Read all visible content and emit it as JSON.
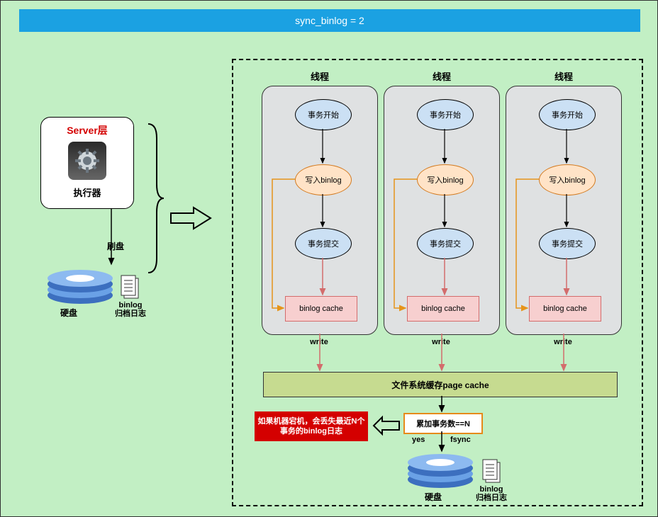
{
  "banner": {
    "title": "sync_binlog = 2"
  },
  "server": {
    "title": "Server层",
    "subtitle": "执行器"
  },
  "flush_label": "刷盘",
  "left_disk": {
    "caption": "硬盘",
    "file_label_line1": "binlog",
    "file_label_line2": "归档日志"
  },
  "threads": {
    "label": "线程",
    "steps": {
      "begin": "事务开始",
      "write_binlog": "写入binlog",
      "commit": "事务提交",
      "cache": "binlog cache"
    },
    "write_label": "write"
  },
  "page_cache": "文件系统缓存page cache",
  "condition": "累加事务数==N",
  "yes": "yes",
  "fsync": "fsync",
  "alert": "如果机器宕机，会丢失最近N个事务的binlog日志",
  "bottom_disk": {
    "caption": "硬盘",
    "file_label_line1": "binlog",
    "file_label_line2": "归档日志"
  }
}
